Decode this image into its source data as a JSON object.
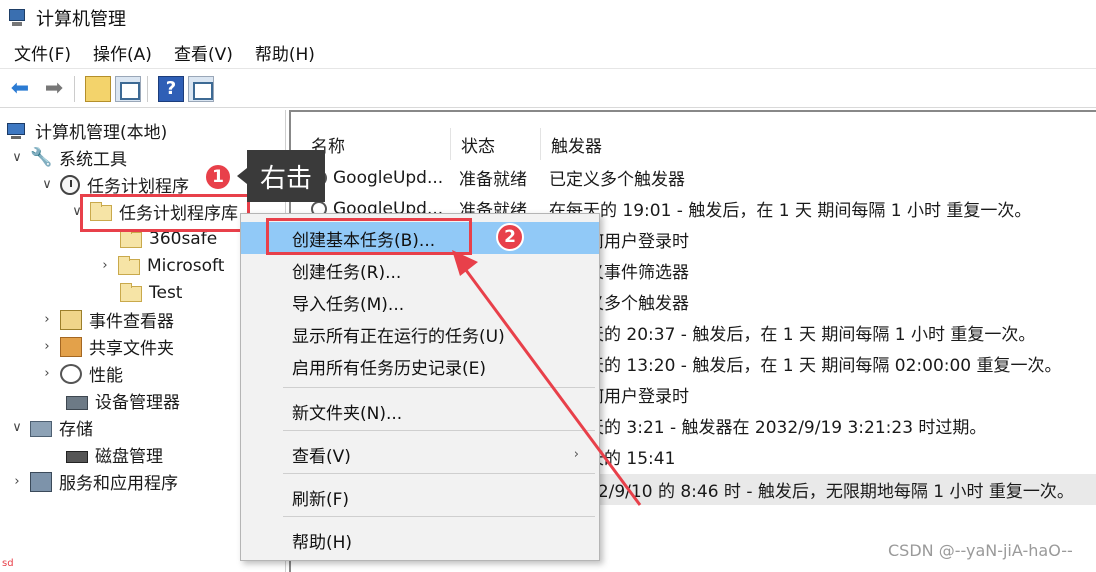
{
  "window": {
    "title": "计算机管理"
  },
  "menubar": {
    "items": [
      "文件(F)",
      "操作(A)",
      "查看(V)",
      "帮助(H)"
    ]
  },
  "toolbar": {
    "buttons": [
      "back-arrow-icon",
      "forward-arrow-icon",
      "up-folder-icon",
      "show-hide-tree-icon",
      "help-icon",
      "action-pane-icon"
    ]
  },
  "tree": {
    "root": "计算机管理(本地)",
    "system_tools": "系统工具",
    "task_scheduler": "任务计划程序",
    "task_scheduler_lib": "任务计划程序库",
    "folder_360": "360safe",
    "folder_ms": "Microsoft",
    "folder_test": "Test",
    "event_viewer": "事件查看器",
    "shared_folders": "共享文件夹",
    "performance": "性能",
    "device_manager": "设备管理器",
    "storage": "存储",
    "disk_mgmt": "磁盘管理",
    "services_apps": "服务和应用程序"
  },
  "list": {
    "headers": {
      "name": "名称",
      "status": "状态",
      "trigger": "触发器"
    },
    "rows": [
      {
        "name": "GoogleUpd...",
        "status": "准备就绪",
        "trigger": "已定义多个触发器"
      },
      {
        "name": "GoogleUpd...",
        "status": "准备就绪",
        "trigger": "在每天的 19:01 - 触发后，在 1 天 期间每隔 1 小时 重复一次。"
      },
      {
        "trigger": "何用户登录时"
      },
      {
        "trigger": "义事件筛选器"
      },
      {
        "trigger": "义多个触发器"
      },
      {
        "trigger": "天的 20:37 - 触发后，在 1 天 期间每隔 1 小时 重复一次。"
      },
      {
        "trigger": "天的 13:20 - 触发后，在 1 天 期间每隔 02:00:00 重复一次。"
      },
      {
        "trigger": "何用户登录时"
      },
      {
        "trigger": "天的 3:21 - 触发器在 2032/9/19 3:21:23 时过期。"
      },
      {
        "trigger": "天的 15:41"
      },
      {
        "trigger": "22/9/10 的 8:46 时 - 触发后，无限期地每隔 1 小时 重复一次。"
      }
    ]
  },
  "context_menu": {
    "items": [
      "创建基本任务(B)...",
      "创建任务(R)...",
      "导入任务(M)...",
      "显示所有正在运行的任务(U)",
      "启用所有任务历史记录(E)",
      "新文件夹(N)...",
      "查看(V)",
      "刷新(F)",
      "帮助(H)"
    ]
  },
  "annotations": {
    "callout": "右击",
    "badge1": "1",
    "badge2": "2",
    "accent_color": "#e8404a",
    "highlight_color": "#91c9f7"
  },
  "watermark": "CSDN @--yaN-jiA-haO--",
  "corner_mark": "sd"
}
